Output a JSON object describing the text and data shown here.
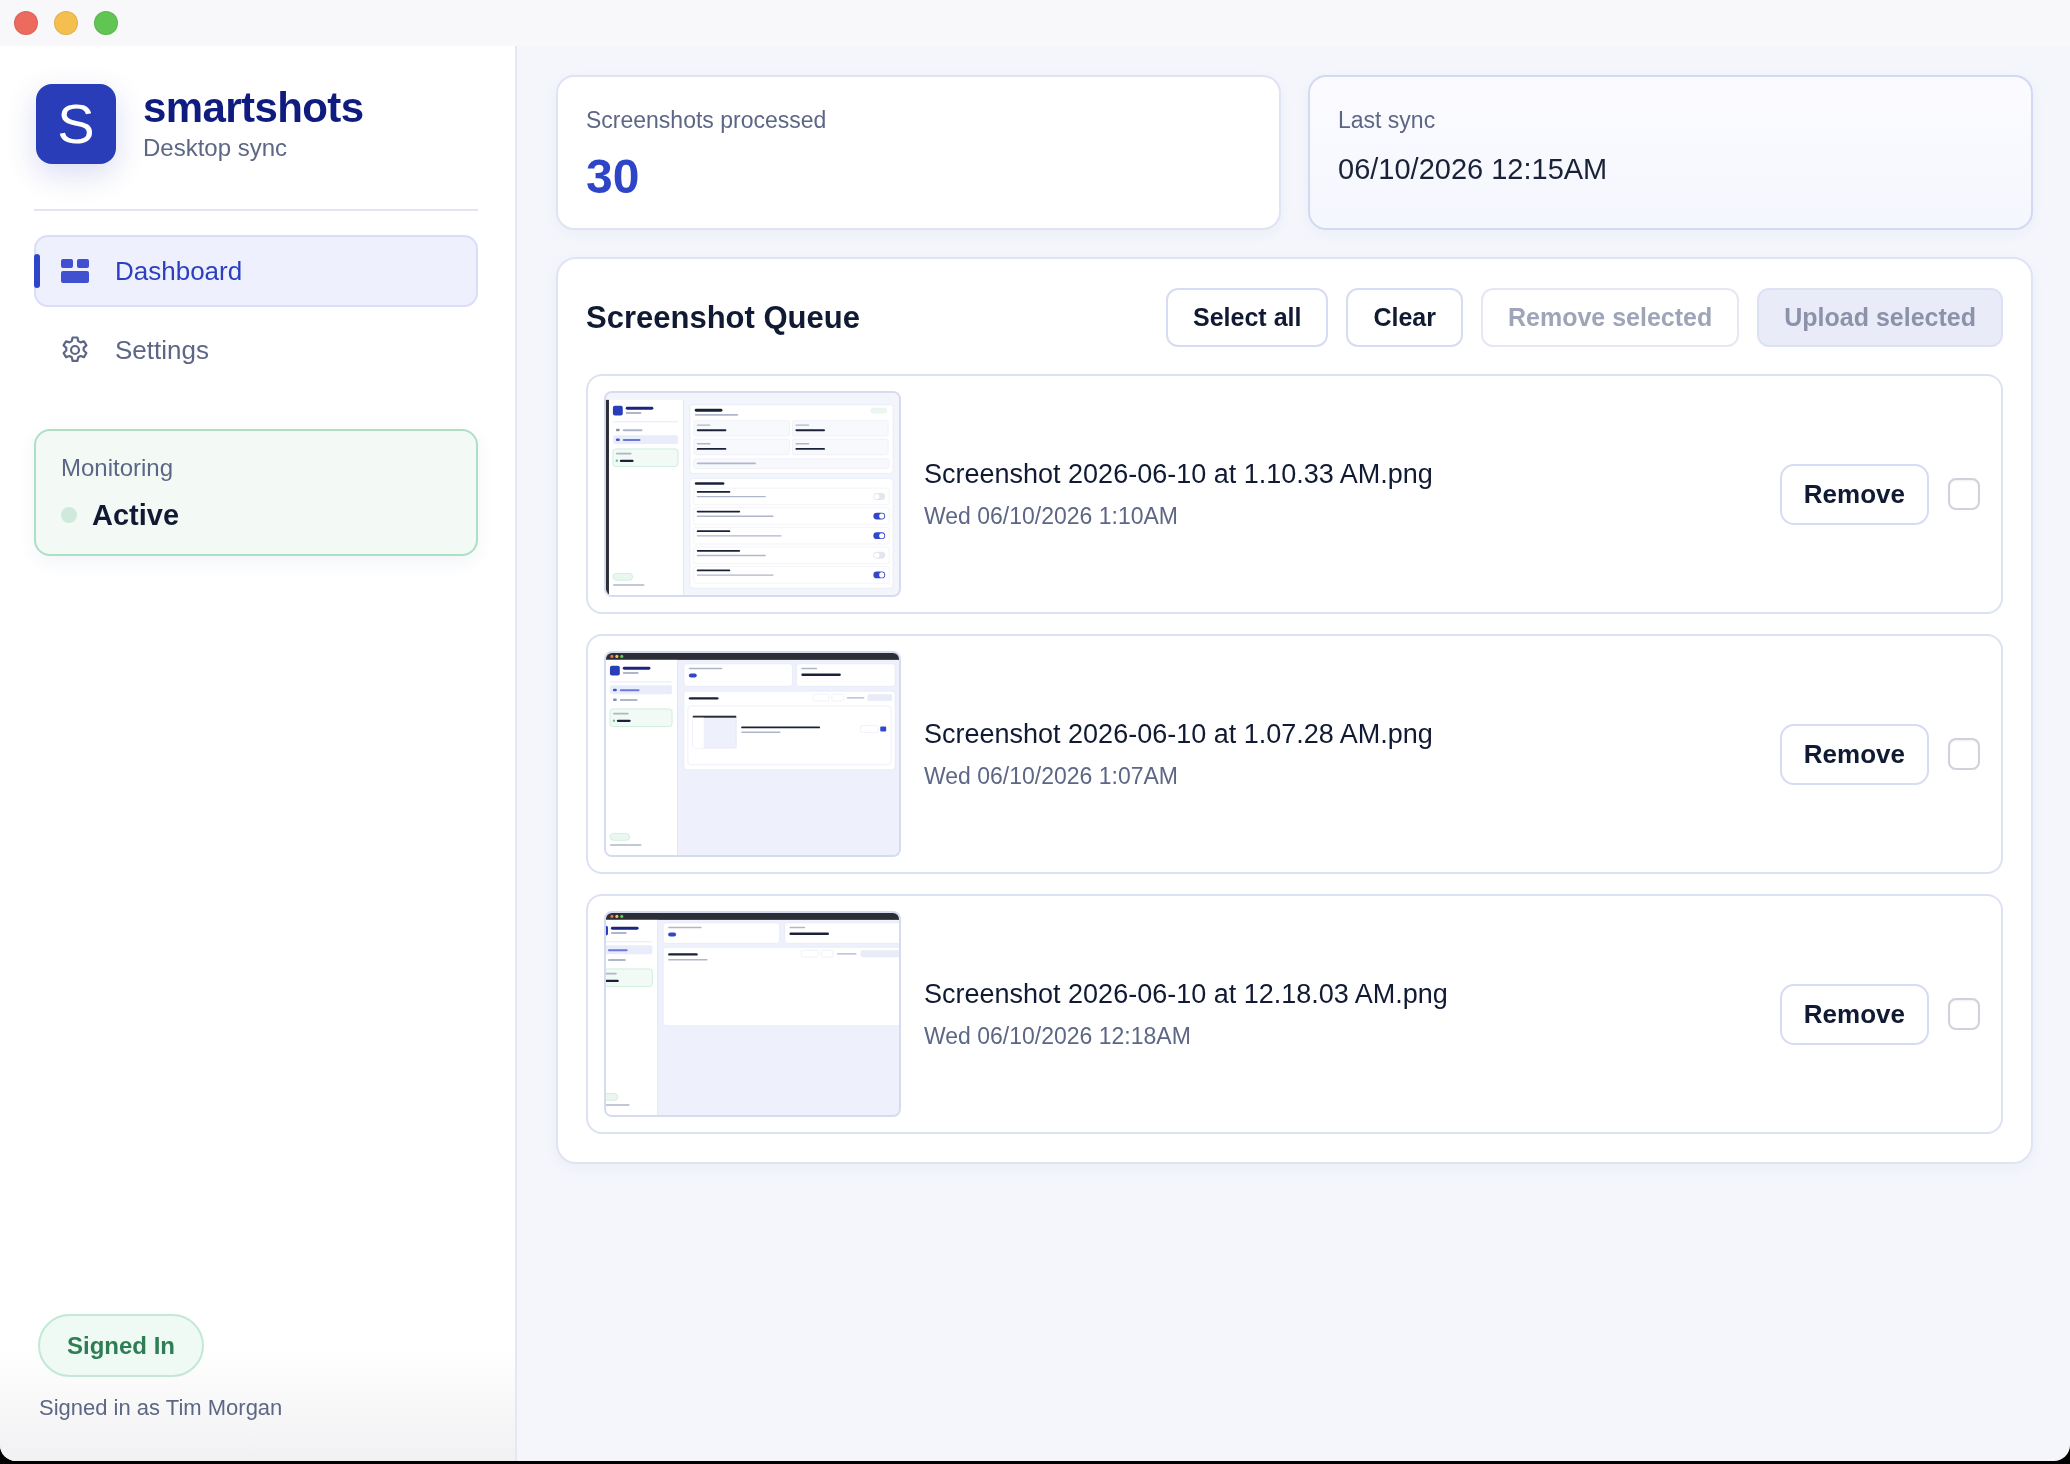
{
  "sidebar": {
    "logo_mark": "S",
    "app_name": "smartshots",
    "tagline": "Desktop sync",
    "nav": [
      {
        "label": "Dashboard",
        "selected": true
      },
      {
        "label": "Settings",
        "selected": false
      }
    ],
    "monitoring": {
      "label": "Monitoring",
      "status": "Active"
    },
    "session": {
      "badge": "Signed In",
      "detail": "Signed in as Tim Morgan"
    }
  },
  "stats": [
    {
      "kind": "count",
      "label": "Screenshots processed",
      "value": "30"
    },
    {
      "kind": "timestamp",
      "label": "Last sync",
      "value": "06/10/2026 12:15AM"
    }
  ],
  "queue": {
    "title": "Screenshot Queue",
    "actions": [
      {
        "label": "Select all",
        "kind": "secondary",
        "disabled": false
      },
      {
        "label": "Clear",
        "kind": "secondary",
        "disabled": false
      },
      {
        "label": "Remove selected",
        "kind": "secondary",
        "disabled": true
      },
      {
        "label": "Upload selected",
        "kind": "primary",
        "disabled": true
      }
    ],
    "items": [
      {
        "filename": "Screenshot 2026-06-10 at 1.10.33 AM.png",
        "date": "Wed 06/10/2026 1:10AM",
        "button": "Remove",
        "checked": false
      },
      {
        "filename": "Screenshot 2026-06-10 at 1.07.28 AM.png",
        "date": "Wed 06/10/2026 1:07AM",
        "button": "Remove",
        "checked": false
      },
      {
        "filename": "Screenshot 2026-06-10 at 12.18.03 AM.png",
        "date": "Wed 06/10/2026 12:18AM",
        "button": "Remove",
        "checked": false
      }
    ]
  }
}
